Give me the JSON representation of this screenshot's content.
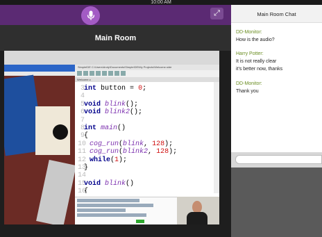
{
  "status_bar": {
    "time": "10:00 AM"
  },
  "room": {
    "title": "Main Room"
  },
  "icons": {
    "mic": "microphone-icon",
    "expand": "expand-arrows-icon"
  },
  "ide": {
    "window_title": "SimpleIDE C:\\Users\\Andy\\Documents\\SimpleIDE\\My Projects\\Welcome.side",
    "tab": "Welcome.c",
    "code_lines": [
      {
        "n": "3",
        "text": "int button = 0;"
      },
      {
        "n": "4",
        "text": ""
      },
      {
        "n": "5",
        "text": "void blink();"
      },
      {
        "n": "6",
        "text": "void blink2();"
      },
      {
        "n": "7",
        "text": ""
      },
      {
        "n": "8",
        "text": "int main()"
      },
      {
        "n": "9",
        "text": "{"
      },
      {
        "n": "10",
        "text": "cog_run(blink, 128);"
      },
      {
        "n": "11",
        "text": "cog_run(blink2, 128);"
      },
      {
        "n": "12",
        "text": "while(1);"
      },
      {
        "n": "13",
        "text": "}"
      },
      {
        "n": "14",
        "text": ""
      },
      {
        "n": "15",
        "text": "void blink()"
      },
      {
        "n": "16",
        "text": "{"
      }
    ]
  },
  "chat": {
    "title": "Main Room Chat",
    "messages": [
      {
        "sender": "DD-Monitor:",
        "lines": [
          "How is the audio?"
        ]
      },
      {
        "sender": "Harry Potter:",
        "lines": [
          "It is not really clear",
          "it's better now, thanks"
        ]
      },
      {
        "sender": "DD-Monitor:",
        "lines": [
          "Thank you"
        ]
      }
    ],
    "input_placeholder": ""
  },
  "colors": {
    "accent_purple": "#5b2a73",
    "mic_purple": "#a35bc4",
    "sender_green": "#6b8e23"
  }
}
